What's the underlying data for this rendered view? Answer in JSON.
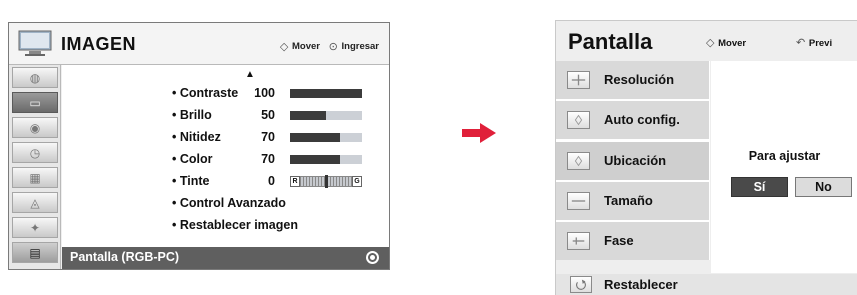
{
  "left_menu": {
    "title": "IMAGEN",
    "hint_move": "Mover",
    "hint_enter": "Ingresar",
    "categories": [
      {
        "icon": "disc-icon"
      },
      {
        "icon": "tv-icon"
      },
      {
        "icon": "speaker-icon"
      },
      {
        "icon": "clock-icon"
      },
      {
        "icon": "calendar-icon"
      },
      {
        "icon": "lock-icon"
      },
      {
        "icon": "usb-icon"
      },
      {
        "icon": "film-icon"
      }
    ],
    "items": [
      {
        "label": "• Contraste",
        "value": "100",
        "level": 100
      },
      {
        "label": "• Brillo",
        "value": "50",
        "level": 50
      },
      {
        "label": "• Nitidez",
        "value": "70",
        "level": 70
      },
      {
        "label": "• Color",
        "value": "70",
        "level": 70
      },
      {
        "label": "• Tinte",
        "value": "0",
        "tint_left": "R",
        "tint_right": "G"
      },
      {
        "label": "• Control Avanzado"
      },
      {
        "label": "• Restablecer imagen"
      }
    ],
    "selected_item": "Pantalla (RGB-PC)"
  },
  "right_menu": {
    "title": "Pantalla",
    "hint_move": "Mover",
    "hint_prev": "Previ",
    "items": [
      {
        "label": "Resolución",
        "icon": "plus-icon"
      },
      {
        "label": "Auto config.",
        "icon": "auto-config-icon"
      },
      {
        "label": "Ubicación",
        "icon": "position-icon"
      },
      {
        "label": "Tamaño",
        "icon": "size-icon"
      },
      {
        "label": "Fase",
        "icon": "phase-icon"
      }
    ],
    "reset_label": "Restablecer",
    "reset_icon": "reset-icon",
    "adjust_label": "Para ajustar",
    "yes_label": "Sí",
    "no_label": "No"
  },
  "colors": {
    "selected_bar": "#5f5f5f",
    "yes_button": "#4a4a4a",
    "arrow": "#e0203a"
  }
}
